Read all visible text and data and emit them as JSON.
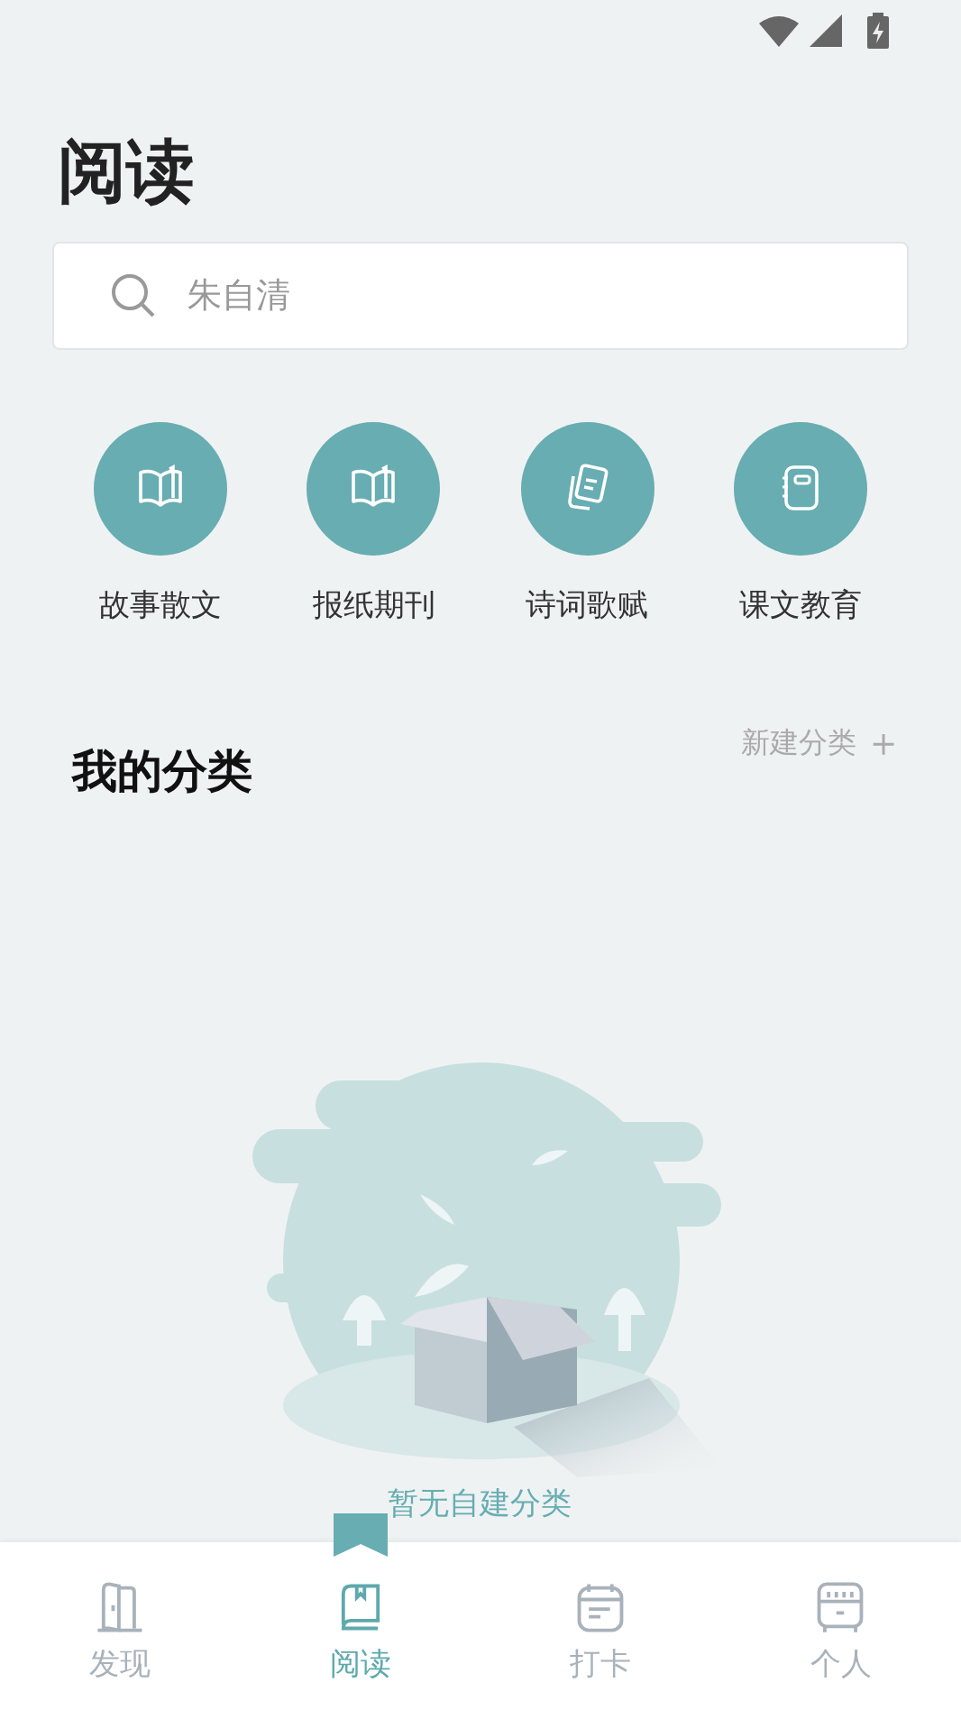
{
  "title": "阅读",
  "search": {
    "placeholder": "朱自清"
  },
  "categories": [
    {
      "label": "故事散文",
      "kind": "book"
    },
    {
      "label": "报纸期刊",
      "kind": "book"
    },
    {
      "label": "诗词歌赋",
      "kind": "cards"
    },
    {
      "label": "课文教育",
      "kind": "notebook"
    }
  ],
  "my_categories": {
    "title": "我的分类",
    "action": "新建分类",
    "action_icon": "＋",
    "empty_text": "暂无自建分类"
  },
  "nav": [
    {
      "label": "发现",
      "kind": "door",
      "selected": false
    },
    {
      "label": "阅读",
      "kind": "book",
      "selected": true
    },
    {
      "label": "打卡",
      "kind": "calendar",
      "selected": false
    },
    {
      "label": "个人",
      "kind": "locker",
      "selected": false
    }
  ]
}
